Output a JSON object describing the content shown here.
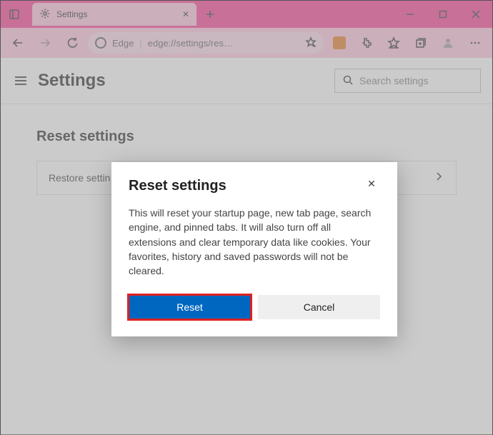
{
  "window": {
    "tab_label": "Settings"
  },
  "addr": {
    "edge_label": "Edge",
    "url": "edge://settings/res…"
  },
  "page": {
    "title": "Settings",
    "search_placeholder": "Search settings",
    "section": "Reset settings",
    "row_label": "Restore settin"
  },
  "dialog": {
    "title": "Reset settings",
    "body": "This will reset your startup page, new tab page, search engine, and pinned tabs. It will also turn off all extensions and clear temporary data like cookies. Your favorites, history and saved passwords will not be cleared.",
    "primary": "Reset",
    "secondary": "Cancel"
  }
}
